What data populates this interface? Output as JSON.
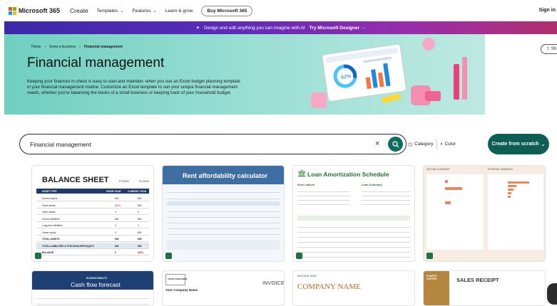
{
  "nav": {
    "brand": "Microsoft 365",
    "create": "Create",
    "templates": "Templates",
    "features": "Features",
    "learn": "Learn & grow",
    "buy": "Buy Microsoft 365",
    "signin": "Sign in"
  },
  "promo": {
    "text": "Design and edit anything you can imagine with AI",
    "link": "Try Microsoft Designer"
  },
  "hero": {
    "breadcrumb": [
      "Home",
      "Grow a business",
      "Financial management"
    ],
    "title": "Financial management",
    "description": "Keeping your finances in check is easy to start-and maintain- when you use an Excel budget planning template in your financial management routine. Customize an Excel template to suit your unique financial management needs, whether you're balancing the books of a small business or keeping track of your household budget.",
    "share": "Sh"
  },
  "search": {
    "value": "Financial management",
    "filter_category": "Category",
    "filter_color": "Color",
    "create": "Create from scratch"
  },
  "cards": {
    "balance": {
      "title": "BALANCE SHEET",
      "fy1": "FY-20XX",
      "fy2": "FY-20XX",
      "col1": "ASSET TYPE",
      "col2": "PRIOR YEAR",
      "col3": "CURRENT YEAR",
      "rows": [
        [
          "Current assets",
          "$00",
          "$00"
        ],
        [
          "Fixed assets",
          "($00)",
          "$00"
        ],
        [
          "Other assets",
          "0",
          "0"
        ],
        [
          "Current liabilities",
          "$00",
          "$00"
        ],
        [
          "Long-term liabilities",
          "0",
          "0"
        ],
        [
          "Owner equity",
          "0",
          "$00"
        ],
        [
          "TOTAL ASSETS",
          "$00",
          "$00"
        ],
        [
          "TOTAL LIABILITIES & STOCKHOLDER EQUITY",
          "$00",
          "$00"
        ],
        [
          "BALANCE",
          "0",
          "($00)"
        ]
      ]
    },
    "rent": {
      "title": "Rent affordability calculator"
    },
    "loan": {
      "title": "Loan Amortization Schedule",
      "enter": "Enter Values",
      "summary": "Loan Summary"
    },
    "dash": {
      "left": "INCOME SUMMARY",
      "right": "EXPENSE SUMMARY"
    },
    "cashflow": {
      "company": "ELEGOS REALTY",
      "title": "Cash flow forecast"
    },
    "invoice": {
      "logo": "YOUR LOGO HERE",
      "title": "INVOICE",
      "company": "Your Company Name"
    },
    "invoice2": {
      "number": "INVOICE #100",
      "company": "COMPANY NAME"
    },
    "receipt": {
      "brand": "FOURTH COFFEE",
      "title": "SALES RECEIPT"
    }
  }
}
